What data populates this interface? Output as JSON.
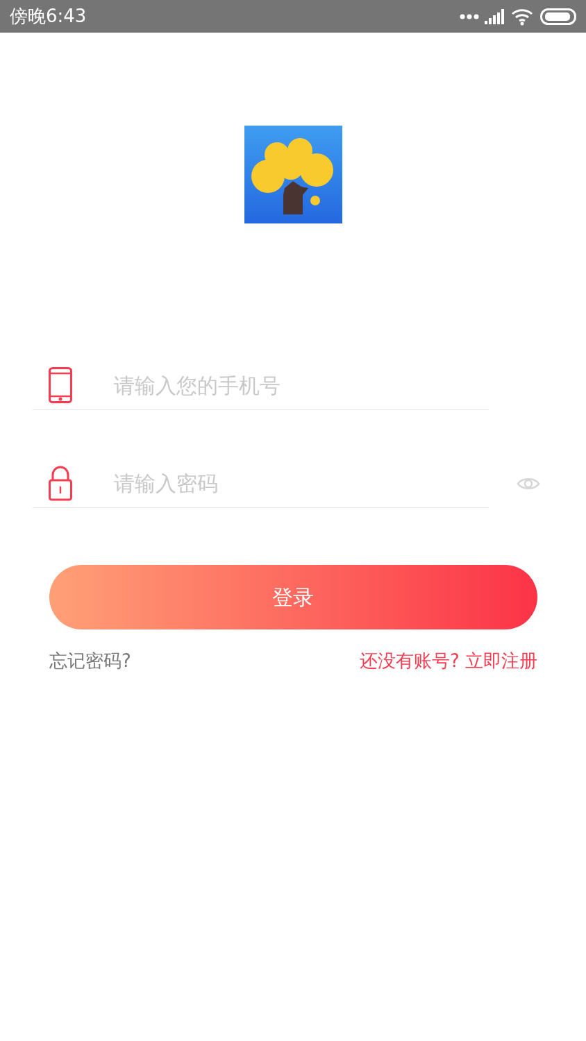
{
  "status_bar": {
    "time": "傍晚6:43"
  },
  "phone_field": {
    "placeholder": "请输入您的手机号"
  },
  "password_field": {
    "placeholder": "请输入密码"
  },
  "login_button": {
    "label": "登录"
  },
  "forgot_link": {
    "label": "忘记密码?"
  },
  "register_link": {
    "label": "还没有账号? 立即注册"
  }
}
